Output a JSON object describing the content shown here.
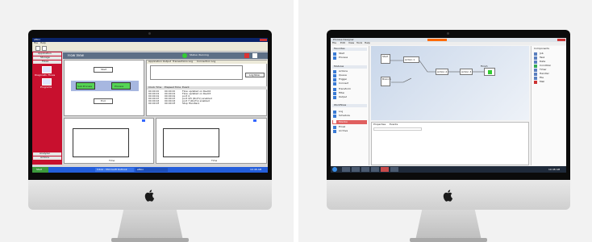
{
  "left_screen": {
    "app_title": "eMoo",
    "menu": [
      "File",
      "Help"
    ],
    "sidebar_headings": [
      "Application",
      "Storage",
      "Flows"
    ],
    "sidebar_icons": [
      "Diagnostic Flows",
      "Programs"
    ],
    "sidebar_bottom": [
      "Analyzer",
      "Actions"
    ],
    "main_title": "Flow View",
    "status_label": "Status: Running",
    "tabs": [
      "Application Output",
      "Transactions Log",
      "Connection Log"
    ],
    "node_labels": [
      "Start",
      "Sub Process",
      "Process",
      "End"
    ],
    "log_button": "Log Now",
    "log_header": [
      "Clock Time",
      "Elapsed Time",
      "Event"
    ],
    "log_rows": [
      [
        "00:00:00",
        "00:00:00",
        "Flow updated on Rev02"
      ],
      [
        "00:00:01",
        "00:00:01",
        "Flow updated on Rev03"
      ],
      [
        "00:00:02",
        "00:00:02",
        "port 4"
      ],
      [
        "00:00:03",
        "00:00:03",
        "port 4/5 (Rx/Tx) enabled"
      ],
      [
        "00:00:04",
        "00:00:04",
        "port 7 (Rx/Tx) enabled"
      ],
      [
        "00:00:05",
        "00:00:05",
        "Stop Handlers"
      ]
    ],
    "chart_label": "Time",
    "taskbar_start": "Start",
    "taskbar_items": [
      "Inbox - Microsoft Outlook",
      "eMoo"
    ],
    "taskbar_time": "10:48 AM"
  },
  "right_screen": {
    "window_title": "Process Designer",
    "menu": [
      "File",
      "Edit",
      "View",
      "Tools",
      "Help"
    ],
    "sidebar_sections": [
      "Favorites",
      "Modules",
      "Workflows"
    ],
    "sidebar_items": [
      "Start",
      "Process",
      "Actions",
      "Queue",
      "Trigger",
      "Connect",
      "Transform",
      "Filter",
      "Output",
      "Log",
      "Schedule",
      "Monitor",
      "Email",
      "Archive"
    ],
    "nodes": [
      "Start",
      "Action 1",
      "Branch",
      "Action 2",
      "Action 3",
      "Finish"
    ],
    "palette_title": "Components",
    "palette_items": [
      "Job",
      "Task",
      "Data",
      "Condition",
      "Timer",
      "Handler",
      "File",
      "Mail"
    ],
    "props_tabs": [
      "Properties",
      "Events"
    ],
    "taskbar_time": "10:48 AM"
  },
  "colors": {
    "app_red": "#c8102e",
    "green": "#33cc33",
    "accent_orange": "#ff6a00",
    "screen_blue": "#dde6f2"
  },
  "icons": [
    "apple-logo-icon",
    "gear-icon",
    "windows-start-icon"
  ]
}
